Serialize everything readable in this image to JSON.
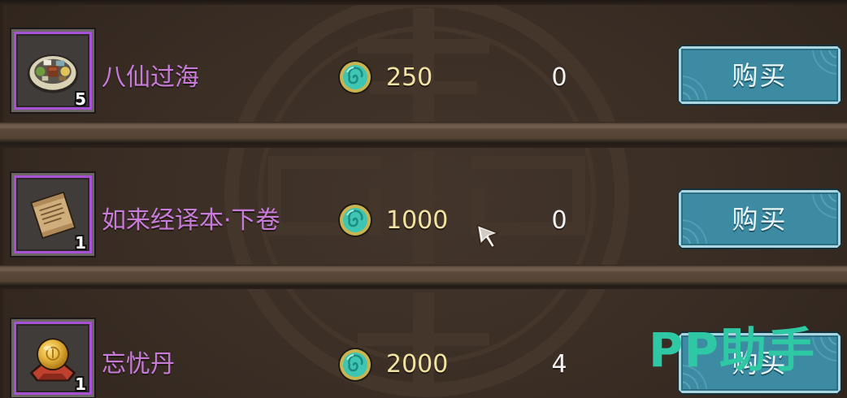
{
  "shop": {
    "currency_icon": "jade-coin-icon",
    "items": [
      {
        "name": "八仙过海",
        "icon": "food-platter-icon",
        "count": "5",
        "price": "250",
        "owned": "0",
        "buy_label": "购买"
      },
      {
        "name": "如来经译本·下卷",
        "icon": "scroll-icon",
        "count": "1",
        "price": "1000",
        "owned": "0",
        "buy_label": "购买"
      },
      {
        "name": "忘忧丹",
        "icon": "golden-orb-icon",
        "count": "1",
        "price": "2000",
        "owned": "4",
        "buy_label": "购买"
      }
    ]
  },
  "watermark": {
    "text": "PP助手"
  },
  "cursor_icon": "mouse-cursor-icon",
  "colors": {
    "item_name": "#c77bd9",
    "price_text": "#f3e3a3",
    "owned_text": "#f2f2f2",
    "rarity_border": "#a651d6",
    "buy_button": "#3c8ba2",
    "watermark": "#2ec8a5"
  }
}
